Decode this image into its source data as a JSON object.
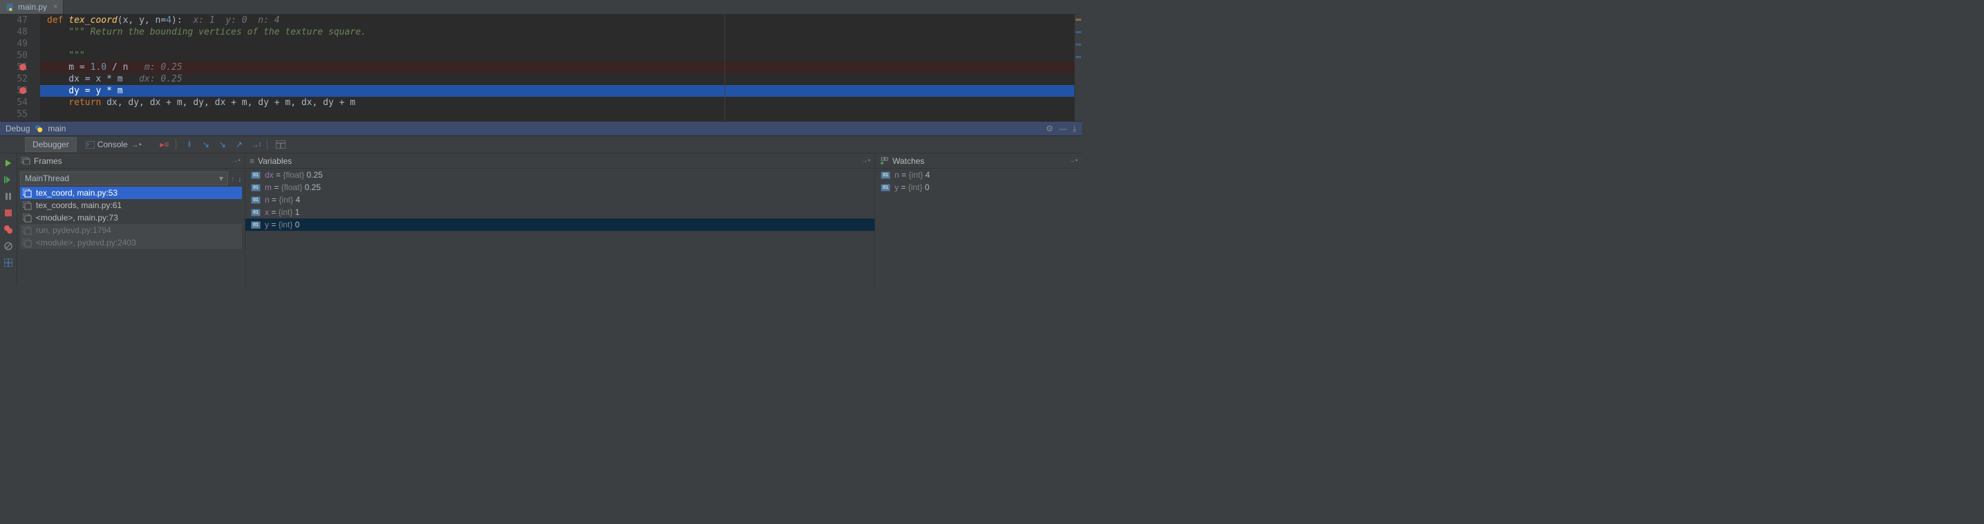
{
  "tab": {
    "filename": "main.py"
  },
  "editor": {
    "lines": [
      {
        "num": "47",
        "bp": false
      },
      {
        "num": "48",
        "bp": false
      },
      {
        "num": "49",
        "bp": false
      },
      {
        "num": "50",
        "bp": false
      },
      {
        "num": "51",
        "bp": true
      },
      {
        "num": "52",
        "bp": false
      },
      {
        "num": "53",
        "bp": true
      },
      {
        "num": "54",
        "bp": false
      },
      {
        "num": "55",
        "bp": false
      }
    ],
    "code": {
      "l47_def": "def ",
      "l47_fn": "tex_coord",
      "l47_sig": "(x, y, n=",
      "l47_n": "4",
      "l47_sig2": "):",
      "l47_hint": "  x: 1  y: 0  n: 4",
      "l48": "    \"\"\" Return the bounding vertices of the texture square.",
      "l49": "",
      "l50": "    \"\"\"",
      "l51_a": "    m = ",
      "l51_n": "1.0",
      "l51_b": " / n",
      "l51_hint": "   m: 0.25",
      "l52_a": "    dx = x * m",
      "l52_hint": "   dx: 0.25",
      "l53": "    dy = y * m",
      "l54_ret": "    return ",
      "l54_rest": "dx, dy, dx + m, dy, dx + m, dy + m, dx, dy + m"
    }
  },
  "debug": {
    "title_prefix": "Debug",
    "title_target": "main",
    "debugger_tab": "Debugger",
    "console_tab": "Console"
  },
  "frames": {
    "header": "Frames",
    "thread": "MainThread",
    "items": [
      {
        "label": "tex_coord, main.py:53",
        "selected": true,
        "dim": false
      },
      {
        "label": "tex_coords, main.py:61",
        "selected": false,
        "dim": false
      },
      {
        "label": "<module>, main.py:73",
        "selected": false,
        "dim": false
      },
      {
        "label": "run, pydevd.py:1794",
        "selected": false,
        "dim": true
      },
      {
        "label": "<module>, pydevd.py:2403",
        "selected": false,
        "dim": true
      }
    ]
  },
  "variables": {
    "header": "Variables",
    "items": [
      {
        "name": "dx",
        "type": "{float}",
        "value": "0.25",
        "selected": false
      },
      {
        "name": "m",
        "type": "{float}",
        "value": "0.25",
        "selected": false
      },
      {
        "name": "n",
        "type": "{int}",
        "value": "4",
        "selected": false
      },
      {
        "name": "x",
        "type": "{int}",
        "value": "1",
        "selected": false
      },
      {
        "name": "y",
        "type": "{int}",
        "value": "0",
        "selected": true
      }
    ]
  },
  "watches": {
    "header": "Watches",
    "items": [
      {
        "name": "n",
        "type": "{int}",
        "value": "4"
      },
      {
        "name": "y",
        "type": "{int}",
        "value": "0"
      }
    ]
  }
}
